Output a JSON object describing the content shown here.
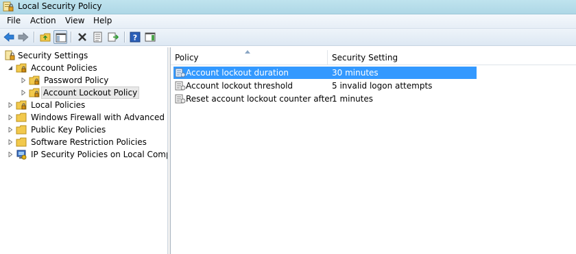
{
  "window": {
    "title": "Local Security Policy"
  },
  "menu": [
    "File",
    "Action",
    "View",
    "Help"
  ],
  "toolbar": {
    "buttons": [
      "back-icon",
      "forward-icon",
      "up-folder-icon",
      "show-hide-tree-icon",
      "delete-icon",
      "properties-icon",
      "export-list-icon",
      "help-icon",
      "show-action-pane-icon"
    ]
  },
  "tree": {
    "root": "Security Settings",
    "nodes": [
      {
        "label": "Account Policies"
      },
      {
        "label": "Password Policy"
      },
      {
        "label": "Account Lockout Policy"
      },
      {
        "label": "Local Policies"
      },
      {
        "label": "Windows Firewall with Advanced Secu"
      },
      {
        "label": "Public Key Policies"
      },
      {
        "label": "Software Restriction Policies"
      },
      {
        "label": "IP Security Policies on Local Compute"
      }
    ]
  },
  "list": {
    "columns": [
      "Policy",
      "Security Setting"
    ],
    "rows": [
      {
        "policy": "Account lockout duration",
        "setting": "30 minutes"
      },
      {
        "policy": "Account lockout threshold",
        "setting": "5 invalid logon attempts"
      },
      {
        "policy": "Reset account lockout counter after",
        "setting": "1 minutes"
      }
    ]
  },
  "colors": {
    "selection": "#3399ff",
    "titlebar": "#aed7e6"
  }
}
